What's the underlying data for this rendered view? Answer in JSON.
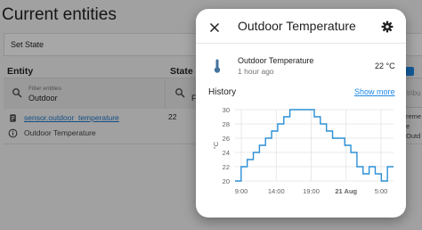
{
  "page": {
    "title": "Current entities",
    "set_state_label": "Set State",
    "columns": {
      "entity": "Entity",
      "state": "State",
      "attributes_partial": "tribu"
    },
    "entity_filter": {
      "label": "Filter entities",
      "value": "Outdoor"
    },
    "state_filter": {
      "value_partial": "F"
    },
    "row": {
      "entity_id": "sensor.outdoor_temperature",
      "friendly_name": "Outdoor Temperature",
      "state": "22",
      "attr_partial_1": "reme",
      "attr_partial_2": "e",
      "attr_partial_3": "Outd"
    }
  },
  "dialog": {
    "title": "Outdoor Temperature",
    "sensor_name": "Outdoor Temperature",
    "last_changed": "1 hour ago",
    "value": "22 °C",
    "history_label": "History",
    "show_more": "Show more",
    "icons": {
      "close": "close-icon",
      "settings": "gear-icon",
      "sensor": "thermometer-icon"
    },
    "accent_color": "#1e88e5",
    "line_color": "#2b8fd6"
  },
  "chart_data": {
    "type": "line",
    "interpolation": "step",
    "ylabel": "°C",
    "ylim": [
      20,
      30
    ],
    "yticks": [
      20,
      22,
      24,
      26,
      28,
      30
    ],
    "xticks": [
      "9:00",
      "14:00",
      "19:00",
      "21 Aug",
      "5:00"
    ],
    "xtick_bold": [
      false,
      false,
      false,
      true,
      false
    ],
    "grid": true,
    "series": [
      {
        "values": [
          20,
          22,
          23,
          24,
          25,
          26,
          27,
          28,
          29,
          30,
          30,
          30,
          30,
          29,
          28,
          27,
          26,
          26,
          25,
          24,
          22,
          21,
          22,
          21,
          20,
          22,
          22
        ]
      }
    ]
  }
}
